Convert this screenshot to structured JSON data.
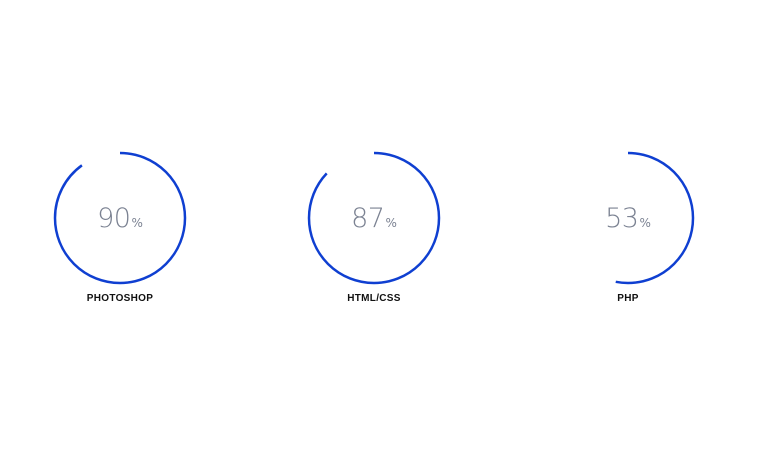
{
  "accent_color": "#0f3fd1",
  "skills": [
    {
      "label": "PHOTOSHOP",
      "percent": 90,
      "percent_text": "90",
      "unit": "%"
    },
    {
      "label": "HTML/CSS",
      "percent": 87,
      "percent_text": "87",
      "unit": "%"
    },
    {
      "label": "PHP",
      "percent": 53,
      "percent_text": "53",
      "unit": "%"
    }
  ]
}
